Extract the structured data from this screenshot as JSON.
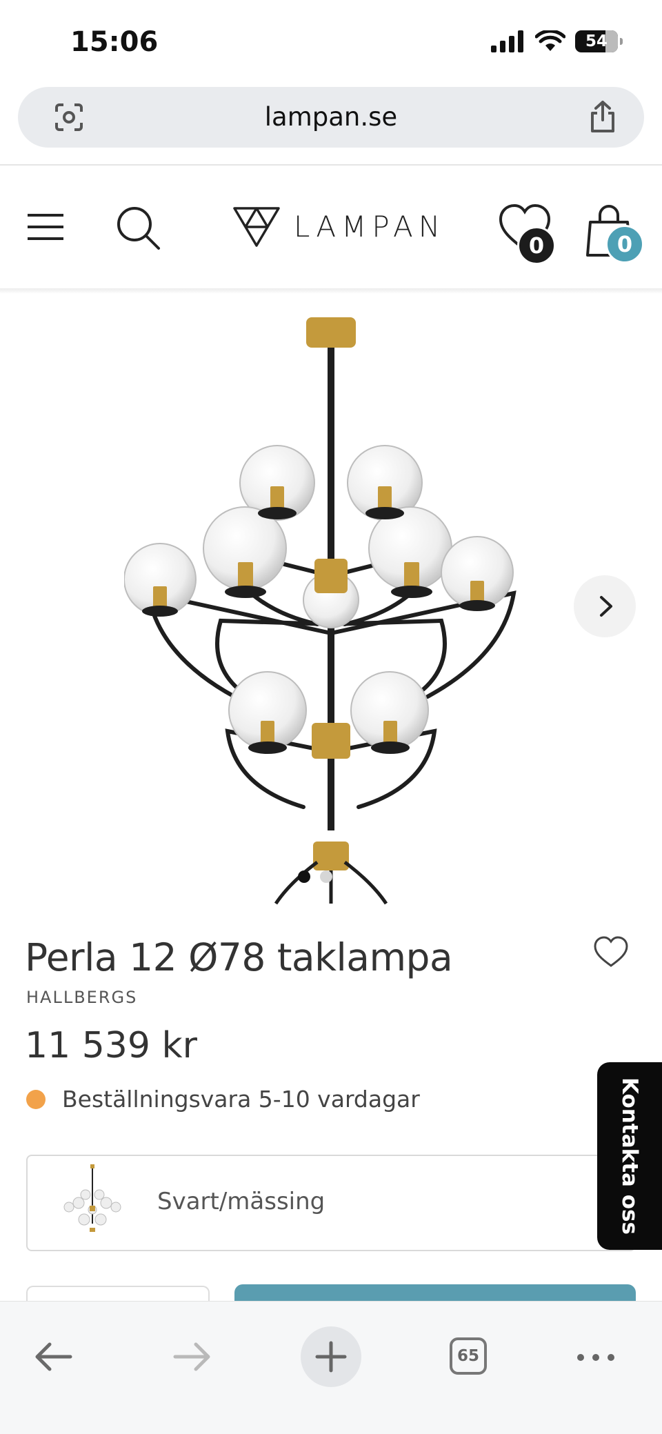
{
  "status_bar": {
    "time": "15:06",
    "battery": "54"
  },
  "browser": {
    "url": "lampan.se",
    "tab_count": "65"
  },
  "site_header": {
    "logo_text": "LAMPAN",
    "wishlist_count": "0",
    "cart_count": "0",
    "accent_color": "#4da0b5"
  },
  "gallery": {
    "slide_count": 2,
    "active_slide": 1
  },
  "product": {
    "title": "Perla 12 Ø78 taklampa",
    "brand": "HALLBERGS",
    "price": "11 539 kr",
    "stock_status": "Beställningsvara 5-10 vardagar",
    "stock_color": "#f2a24a",
    "variant": "Svart/mässing"
  },
  "contact_tab": {
    "label": "Kontakta oss"
  },
  "icons": {
    "status": [
      "signal-icon",
      "wifi-icon",
      "battery-icon"
    ],
    "header": [
      "menu-icon",
      "search-icon",
      "heart-icon",
      "cart-icon"
    ],
    "toolbar": [
      "back-icon",
      "forward-icon",
      "plus-icon",
      "tabs-icon",
      "more-icon"
    ]
  }
}
